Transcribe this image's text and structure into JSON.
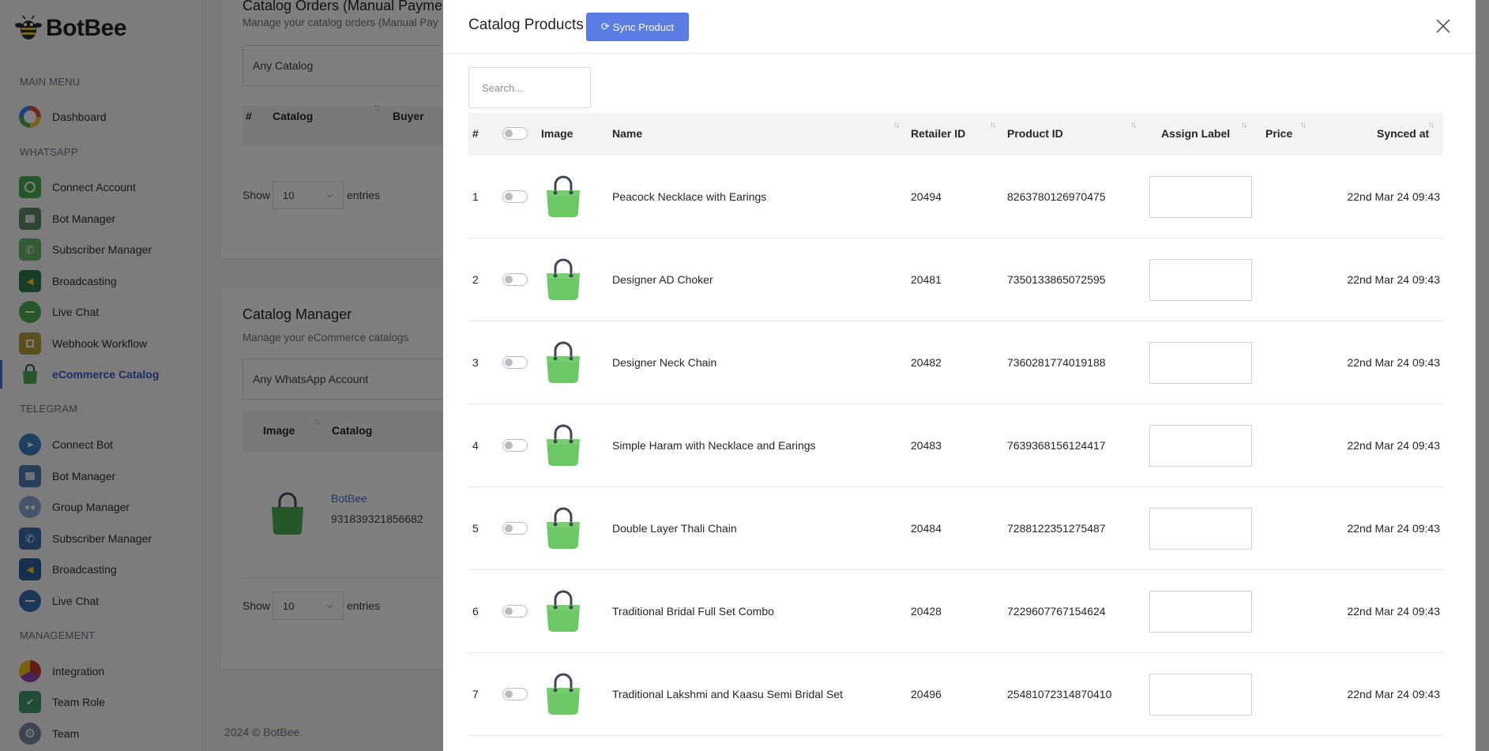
{
  "brand": {
    "name": "BotBee"
  },
  "sidebar": {
    "sections": [
      {
        "title": "MAIN MENU"
      },
      {
        "title": "WHATSAPP"
      },
      {
        "title": "TELEGRAM"
      },
      {
        "title": "MANAGEMENT"
      }
    ],
    "items": [
      {
        "label": "Dashboard",
        "icon": "dashboard-gauge-icon"
      },
      {
        "label": "Connect Account",
        "icon": "whatsapp-icon"
      },
      {
        "label": "Bot Manager",
        "icon": "robot-icon"
      },
      {
        "label": "Subscriber Manager",
        "icon": "phone-icon"
      },
      {
        "label": "Broadcasting",
        "icon": "megaphone-icon"
      },
      {
        "label": "Live Chat",
        "icon": "chat-icon"
      },
      {
        "label": "Webhook Workflow",
        "icon": "workflow-icon"
      },
      {
        "label": "eCommerce Catalog",
        "icon": "shopping-bag-icon"
      },
      {
        "label": "Connect Bot",
        "icon": "telegram-icon"
      },
      {
        "label": "Bot Manager",
        "icon": "robot-icon"
      },
      {
        "label": "Group Manager",
        "icon": "group-icon"
      },
      {
        "label": "Subscriber Manager",
        "icon": "phone-icon"
      },
      {
        "label": "Broadcasting",
        "icon": "megaphone-icon"
      },
      {
        "label": "Live Chat",
        "icon": "chat-icon"
      },
      {
        "label": "Integration",
        "icon": "integration-icon"
      },
      {
        "label": "Team Role",
        "icon": "shield-icon"
      },
      {
        "label": "Team",
        "icon": "gear-icon"
      }
    ]
  },
  "background": {
    "orders": {
      "title": "Catalog Orders (Manual Paymen",
      "subtitle": "Manage your catalog orders (Manual Pay",
      "filter": "Any Catalog",
      "headers": [
        "#",
        "Catalog",
        "Buyer"
      ],
      "show": "Show",
      "entries_value": "10",
      "entries": "entries"
    },
    "manager": {
      "title": "Catalog Manager",
      "subtitle": "Manage your eCommerce catalogs",
      "filter": "Any WhatsApp Account",
      "headers": [
        "Image",
        "Catalog"
      ],
      "catalog_name": "BotBee",
      "catalog_id": "931839321856682",
      "show": "Show",
      "entries_value": "10",
      "entries": "entries"
    },
    "footer": "2024 © BotBee"
  },
  "panel": {
    "title": "Catalog Products",
    "sync_label": "Sync Product",
    "search_placeholder": "Search...",
    "columns": [
      "#",
      "Image",
      "Name",
      "Retailer ID",
      "Product ID",
      "Assign Label",
      "Price",
      "Synced at"
    ],
    "rows": [
      {
        "num": "1",
        "name": "Peacock Necklace with Earings",
        "retailer_id": "20494",
        "product_id": "8263780126970475",
        "price": "",
        "synced": "22nd Mar 24 09:43"
      },
      {
        "num": "2",
        "name": "Designer AD Choker",
        "retailer_id": "20481",
        "product_id": "7350133865072595",
        "price": "",
        "synced": "22nd Mar 24 09:43"
      },
      {
        "num": "3",
        "name": "Designer Neck Chain",
        "retailer_id": "20482",
        "product_id": "7360281774019188",
        "price": "",
        "synced": "22nd Mar 24 09:43"
      },
      {
        "num": "4",
        "name": "Simple Haram with Necklace and Earings",
        "retailer_id": "20483",
        "product_id": "7639368156124417",
        "price": "",
        "synced": "22nd Mar 24 09:43"
      },
      {
        "num": "5",
        "name": "Double Layer Thali Chain",
        "retailer_id": "20484",
        "product_id": "7288122351275487",
        "price": "",
        "synced": "22nd Mar 24 09:43"
      },
      {
        "num": "6",
        "name": "Traditional Bridal Full Set Combo",
        "retailer_id": "20428",
        "product_id": "7229607767154624",
        "price": "",
        "synced": "22nd Mar 24 09:43"
      },
      {
        "num": "7",
        "name": "Traditional Lakshmi and Kaasu Semi Bridal Set",
        "retailer_id": "20496",
        "product_id": "25481072314870410",
        "price": "",
        "synced": "22nd Mar 24 09:43"
      }
    ]
  },
  "colors": {
    "accent": "#5b7ee5",
    "bag_green": "#6cc864",
    "active_nav": "#3b5bc4"
  }
}
